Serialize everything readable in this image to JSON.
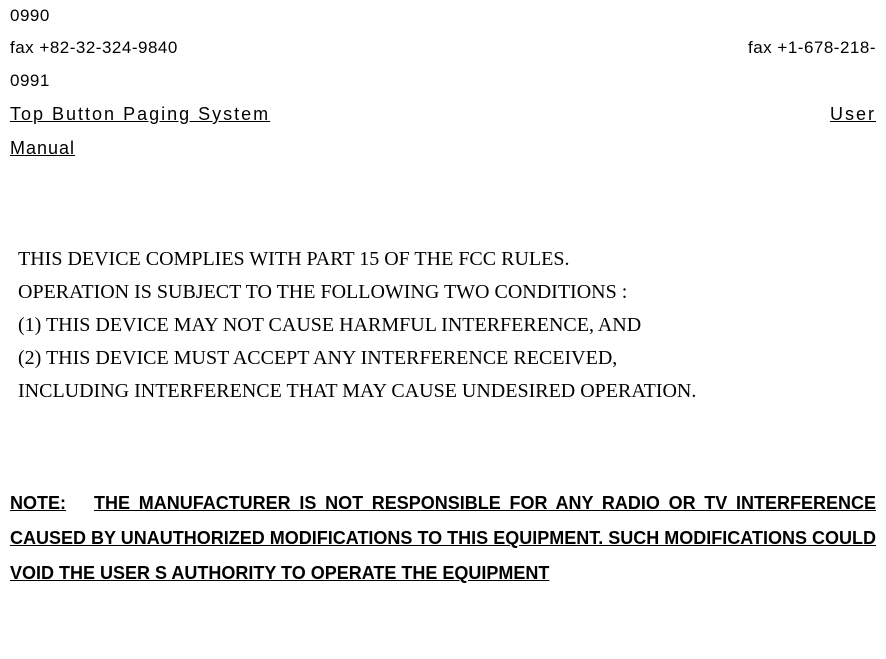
{
  "header": {
    "topNumber": "0990",
    "faxLeft": "fax +82-32-324-9840",
    "faxRight": "fax +1-678-218-",
    "nextNumber": "0991",
    "titleLeft": "Top  Button  Paging  System",
    "titleRight": "User",
    "titleBottom": "Manual"
  },
  "compliance": {
    "line1": "THIS DEVICE COMPLIES WITH PART 15 OF THE FCC RULES.",
    "line2": "OPERATION IS SUBJECT TO THE FOLLOWING TWO CONDITIONS :",
    "line3": "(1) THIS DEVICE MAY NOT CAUSE HARMFUL INTERFERENCE, AND",
    "line4": "(2) THIS DEVICE MUST ACCEPT ANY INTERFERENCE RECEIVED,",
    "line5": "INCLUDING INTERFERENCE THAT MAY CAUSE UNDESIRED OPERATION."
  },
  "note": {
    "prefix": "NOTE:",
    "body": "THE MANUFACTURER IS NOT RESPONSIBLE FOR ANY RADIO OR TV INTERFERENCE CAUSED BY UNAUTHORIZED MODIFICATIONS TO THIS EQUIPMENT.    SUCH MODIFICATIONS COULD VOID THE USER  S AUTHORITY TO OPERATE THE EQUIPMENT"
  }
}
